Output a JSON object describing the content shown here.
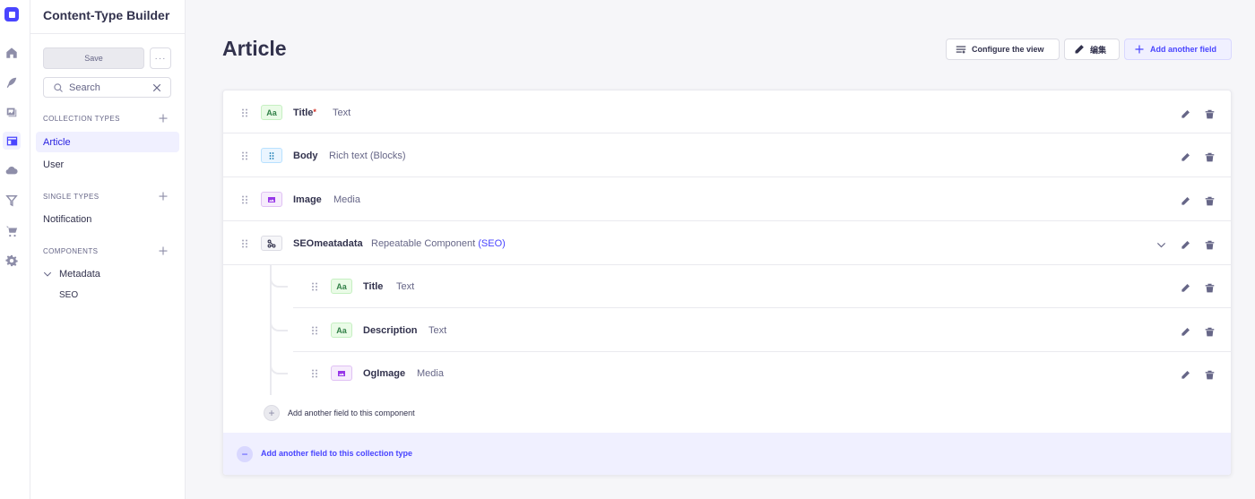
{
  "sidebar": {
    "title": "Content-Type Builder",
    "save_label": "Save",
    "more_label": "···",
    "search_placeholder": "Search",
    "sections": {
      "collection": {
        "label": "COLLECTION TYPES",
        "items": [
          "Article",
          "User"
        ]
      },
      "single": {
        "label": "SINGLE TYPES",
        "items": [
          "Notification"
        ]
      },
      "components": {
        "label": "COMPONENTS",
        "category": "Metadata",
        "items": [
          "SEO"
        ]
      }
    }
  },
  "header": {
    "title": "Article",
    "configure_label": "Configure the view",
    "edit_label": "编集",
    "add_field_label": "Add another field"
  },
  "fields": [
    {
      "icon": "Aa",
      "name": "Title",
      "required_mark": "*",
      "type": "Text"
    },
    {
      "icon": "blocks",
      "name": "Body",
      "type": "Rich text (Blocks)"
    },
    {
      "icon": "media",
      "name": "Image",
      "type": "Media"
    },
    {
      "icon": "component",
      "name": "SEOmeatadata",
      "type": "Repeatable Component",
      "type_link": "(SEO)"
    }
  ],
  "component_fields": [
    {
      "icon": "Aa",
      "name": "Title",
      "type": "Text"
    },
    {
      "icon": "Aa",
      "name": "Description",
      "type": "Text"
    },
    {
      "icon": "media",
      "name": "OgImage",
      "type": "Media"
    }
  ],
  "add_component_field_label": "Add another field to this component",
  "add_collection_field_label": "Add another field to this collection type",
  "colors": {
    "accent": "#4945ff",
    "accent_light": "#f0f0ff",
    "text": "#32324d",
    "muted": "#666687"
  }
}
